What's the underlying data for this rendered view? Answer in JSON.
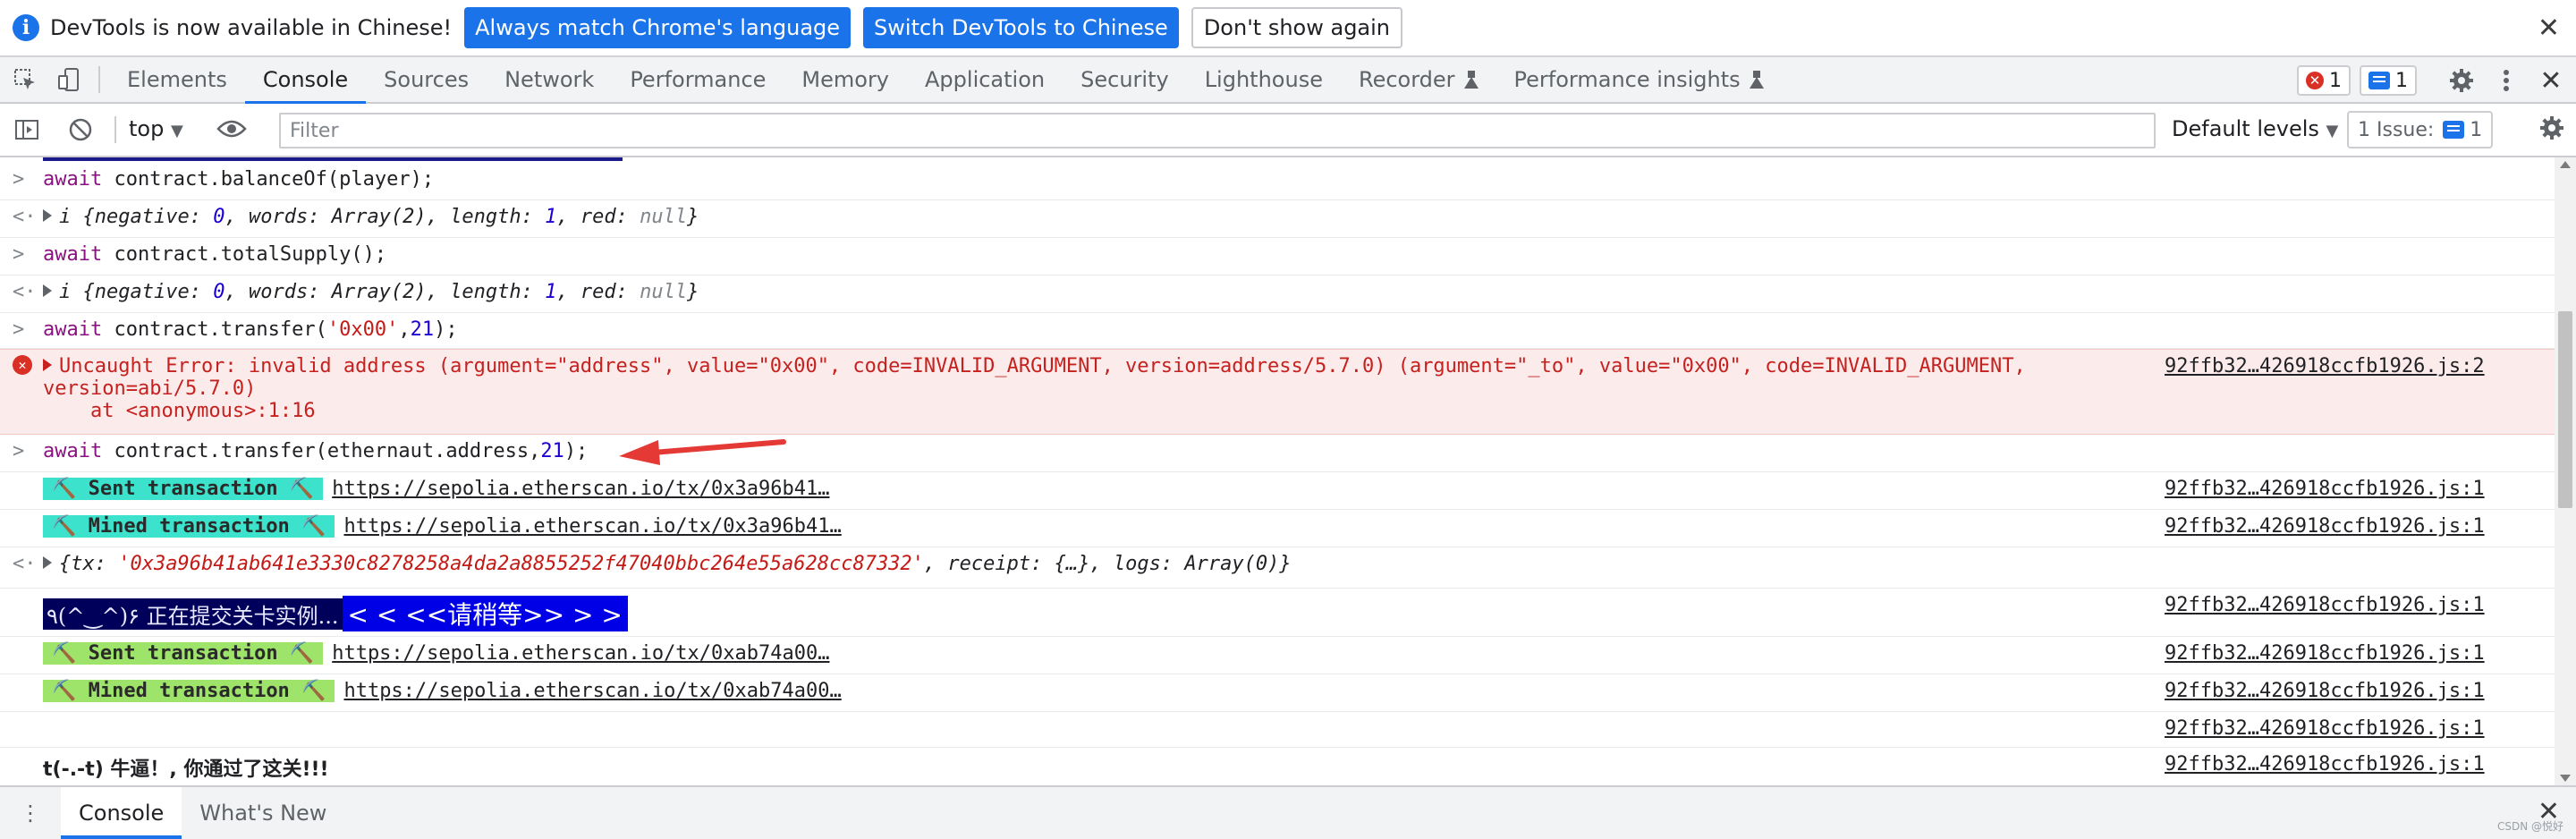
{
  "infobar": {
    "message": "DevTools is now available in Chinese!",
    "btn_match": "Always match Chrome's language",
    "btn_switch": "Switch DevTools to Chinese",
    "btn_dont_show": "Don't show again",
    "close": "✕"
  },
  "tabs": [
    {
      "label": "Elements",
      "active": false
    },
    {
      "label": "Console",
      "active": true
    },
    {
      "label": "Sources",
      "active": false
    },
    {
      "label": "Network",
      "active": false
    },
    {
      "label": "Performance",
      "active": false
    },
    {
      "label": "Memory",
      "active": false
    },
    {
      "label": "Application",
      "active": false
    },
    {
      "label": "Security",
      "active": false
    },
    {
      "label": "Lighthouse",
      "active": false
    },
    {
      "label": "Recorder",
      "active": false
    },
    {
      "label": "Performance insights",
      "active": false
    }
  ],
  "tabbar_right": {
    "error_count": "1",
    "message_count": "1",
    "close": "✕"
  },
  "console_toolbar": {
    "context": "top",
    "filter_placeholder": "Filter",
    "levels": "Default levels",
    "issues_label": "1 Issue:",
    "issues_count": "1"
  },
  "console": {
    "source_file": "92ffb32…426918ccfb1926.js:1",
    "source_file_err": "92ffb32…426918ccfb1926.js:2",
    "cmd1": "contract.balanceOf(player);",
    "cmd2": "contract.totalSupply();",
    "cmd3_pre": "contract.transfer(",
    "cmd3_str": "'0x00'",
    "cmd3_num": "21",
    "cmd4_pre": "contract.transfer(ethernaut.address,",
    "cmd4_num": "21",
    "await_kw": "await",
    "bn_prefix": "i ",
    "bn_negative": "negative",
    "bn_words": "words",
    "bn_length": "length",
    "bn_red": "red",
    "bn_zero": "0",
    "bn_array": "Array(2)",
    "bn_one": "1",
    "bn_null": "null",
    "error_line1": "Uncaught Error: invalid address (argument=\"address\", value=\"0x00\", code=INVALID_ARGUMENT, version=address/5.7.0) (argument=\"_to\", value=\"0x00\", code=INVALID_ARGUMENT,",
    "error_line2": "version=abi/5.7.0)",
    "error_line3": "    at <anonymous>:1:16",
    "sent_tag": "⛏️ Sent transaction ⛏️",
    "mined_tag": "⛏️ Mined transaction ⛏️",
    "tx1_link": "https://sepolia.etherscan.io/tx/0x3a96b41…",
    "tx2_link": "https://sepolia.etherscan.io/tx/0xab74a00…",
    "result_tx_key": "tx",
    "result_tx_val": "'0x3a96b41ab641e3330c8278258a4da2a8855252f47040bbc264e55a628cc87332'",
    "result_receipt": "receipt: {…}",
    "result_logs": "logs: Array(0)",
    "submit_a": "٩(^‿^)۶ 正在提交关卡实例...",
    "submit_b": "< < <<请稍等>> > >",
    "passed": "t(-.-t) 牛逼！, 你通过了这关!!!"
  },
  "drawer": {
    "menu": "⋮",
    "tab_console": "Console",
    "tab_whatsnew": "What's New",
    "close": "✕",
    "watermark": "CSDN @悦好"
  },
  "colors": {
    "accent": "#1a73e8",
    "error_bg": "#fcebeb",
    "error_text": "#c5221f",
    "sent_tag_bg": "#3ce2cb",
    "mined_tag_bg": "#9ee36a",
    "arrow": "#e53935"
  },
  "icons": {
    "inspect": "inspect-element-icon",
    "device": "device-toolbar-icon",
    "sidebar": "sidebar-toggle-icon",
    "clear": "clear-console-icon",
    "eye": "live-expression-icon",
    "gear": "gear-icon",
    "more": "more-vertical-icon"
  }
}
